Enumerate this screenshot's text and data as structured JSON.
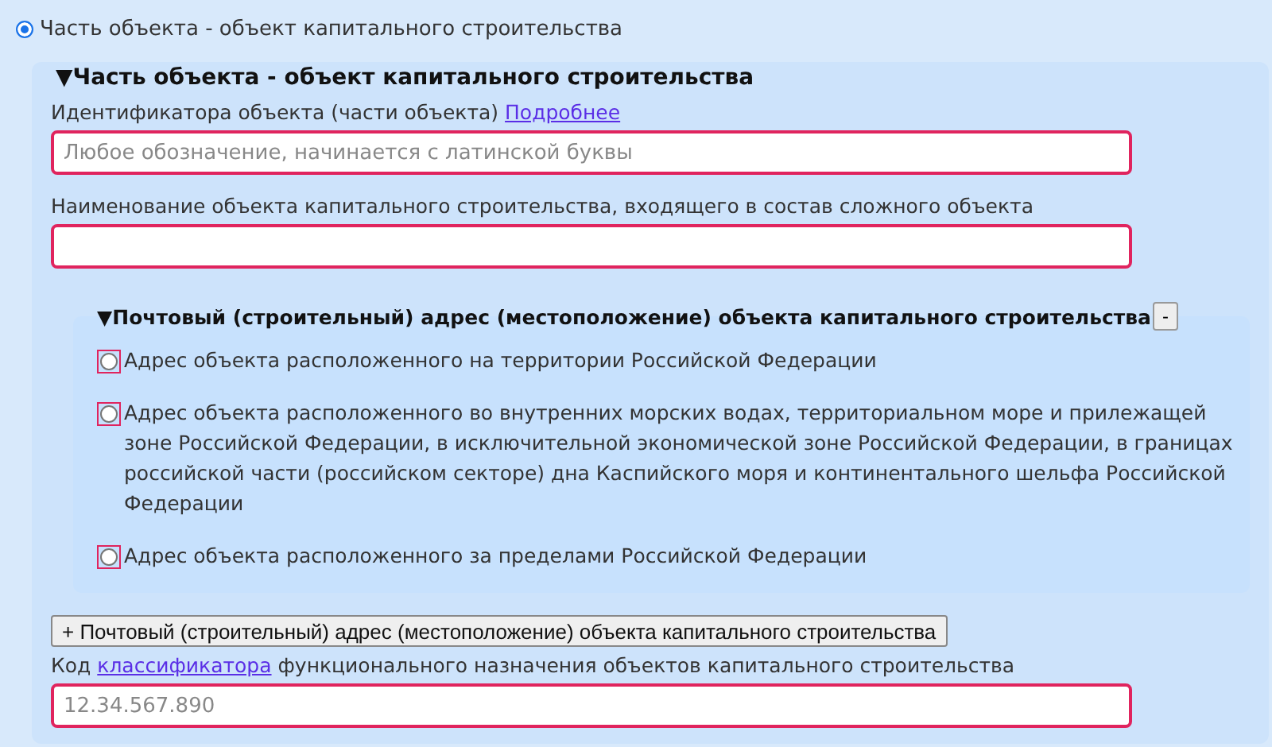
{
  "top_option": {
    "label": "Часть объекта - объект капитального строительства",
    "selected": true
  },
  "section": {
    "toggle": "▼",
    "title": "Часть объекта - объект капитального строительства",
    "fields": [
      {
        "label": "Идентификатора объекта (части объекта)",
        "link": "Подробнее",
        "placeholder": "Любое обозначение, начинается с латинской буквы"
      },
      {
        "label": "Наименование объекта капитального строительства, входящего в состав сложного объекта"
      }
    ],
    "address": {
      "toggle": "▼",
      "title": "Почтовый (строительный) адрес (местоположение) объекта капитального строительства",
      "collapse_button": "-",
      "options": [
        {
          "label": "Адрес объекта расположенного на территории Российской Федерации",
          "selected": false
        },
        {
          "label": "Адрес объекта расположенного во внутренних морских водах, территориальном море и прилежащей зоне Российской Федерации, в исключительной экономической зоне Российской Федерации, в границах российской части (российском секторе) дна Каспийского моря и континентального шельфа Российской Федерации",
          "selected": false
        },
        {
          "label": "Адрес объекта расположенного за пределами Российской Федерации",
          "selected": false
        }
      ]
    },
    "add_button": "+ Почтовый (строительный) адрес (местоположение) объекта капитального строительства",
    "code_field": {
      "before": "Код ",
      "link": "классификатора",
      "after": " функционального назначения объектов капитального строительства",
      "placeholder": "12.34.567.890"
    }
  }
}
